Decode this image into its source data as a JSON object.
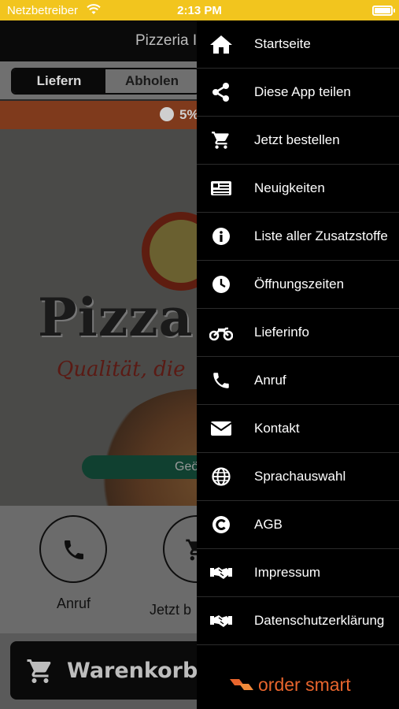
{
  "status_bar": {
    "carrier": "Netzbetreiber",
    "time": "2:13 PM"
  },
  "app": {
    "title": "Pizzeria I",
    "tabs": [
      {
        "label": "Liefern",
        "active": true
      },
      {
        "label": "Abholen",
        "active": false
      }
    ],
    "promo": "5%",
    "hero": {
      "brand": "Pizza",
      "tagline": "Qualität, die",
      "pill": "Geö"
    },
    "actions": [
      {
        "label": "Anruf",
        "icon": "phone-icon"
      },
      {
        "label": "Jetzt b",
        "icon": "cart-icon"
      }
    ],
    "cart_label": "Warenkorb"
  },
  "drawer": {
    "items": [
      {
        "label": "Startseite",
        "icon": "home-icon"
      },
      {
        "label": "Diese App teilen",
        "icon": "share-icon"
      },
      {
        "label": "Jetzt bestellen",
        "icon": "cart-icon"
      },
      {
        "label": "Neuigkeiten",
        "icon": "news-icon"
      },
      {
        "label": "Liste aller Zusatzstoffe",
        "icon": "info-icon"
      },
      {
        "label": "Öffnungszeiten",
        "icon": "clock-icon"
      },
      {
        "label": "Lieferinfo",
        "icon": "motorbike-icon"
      },
      {
        "label": "Anruf",
        "icon": "phone-icon"
      },
      {
        "label": "Kontakt",
        "icon": "envelope-icon"
      },
      {
        "label": "Sprachauswahl",
        "icon": "globe-icon"
      },
      {
        "label": "AGB",
        "icon": "copyright-icon"
      },
      {
        "label": "Impressum",
        "icon": "handshake-icon"
      },
      {
        "label": "Datenschutzerklärung",
        "icon": "handshake-icon"
      }
    ],
    "footer_brand": "order smart"
  },
  "colors": {
    "status_bar": "#f2c51e",
    "drawer_bg": "#000000",
    "brand_orange": "#e8652d",
    "promo_bg": "#7f3a1c"
  }
}
